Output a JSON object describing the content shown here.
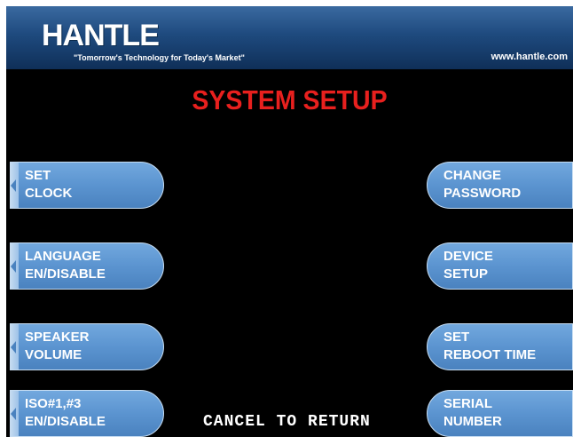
{
  "header": {
    "logo_text": "HANTLE",
    "tagline": "\"Tomorrow's Technology for Today's Market\"",
    "website": "www.hantle.com"
  },
  "title": "SYSTEM SETUP",
  "left_buttons": [
    {
      "line1": "SET",
      "line2": "CLOCK"
    },
    {
      "line1": "LANGUAGE",
      "line2": "EN/DISABLE"
    },
    {
      "line1": "SPEAKER",
      "line2": "VOLUME"
    },
    {
      "line1": "ISO#1,#3",
      "line2": "EN/DISABLE"
    }
  ],
  "right_buttons": [
    {
      "line1": "CHANGE",
      "line2": "PASSWORD"
    },
    {
      "line1": "DEVICE",
      "line2": "SETUP"
    },
    {
      "line1": "SET",
      "line2": "REBOOT TIME"
    },
    {
      "line1": "SERIAL",
      "line2": "NUMBER"
    }
  ],
  "footer": {
    "cancel_text": "CANCEL TO RETURN"
  },
  "colors": {
    "title_red": "#e8201e",
    "button_blue": "#5b94d0",
    "header_blue": "#1e4a7e",
    "background": "#000000"
  }
}
